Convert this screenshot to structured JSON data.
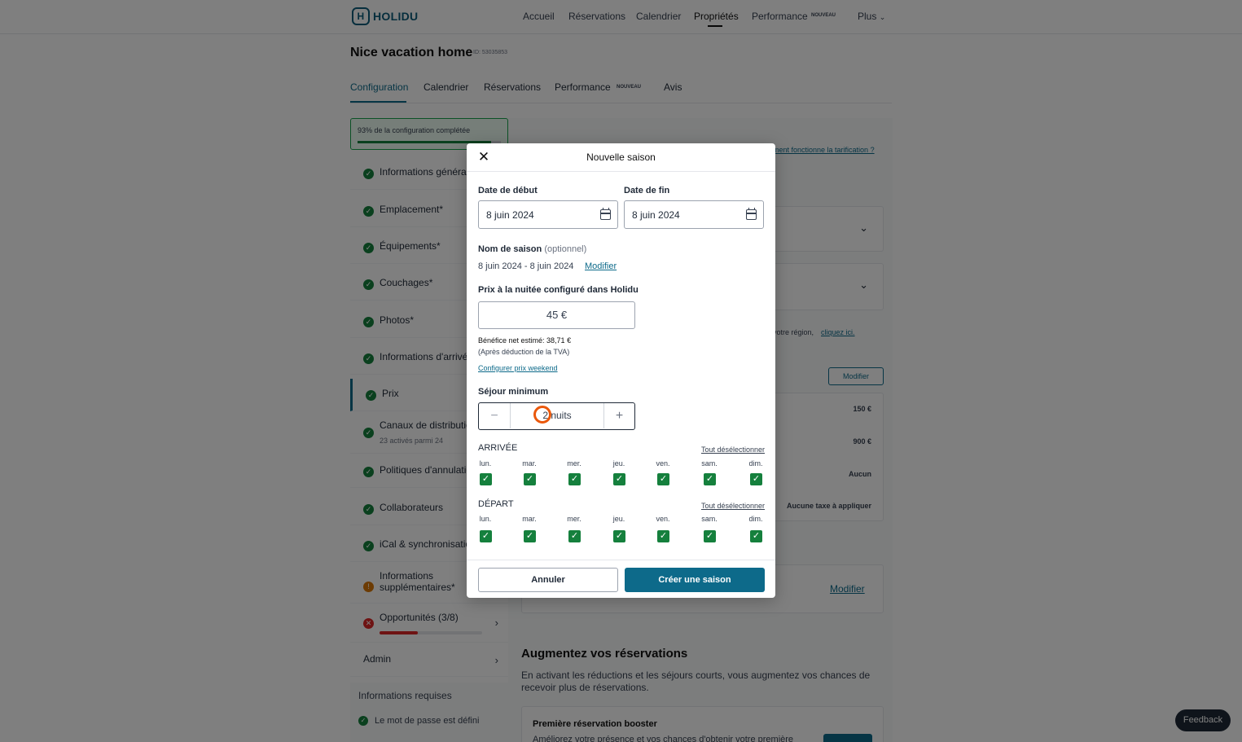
{
  "header": {
    "logo": "HOLIDU",
    "nav": [
      "Accueil",
      "Réservations",
      "Calendrier",
      "Propriétés",
      "Performance",
      "Plus"
    ],
    "performance_badge": "NOUVEAU",
    "active_nav": "Propriétés"
  },
  "property": {
    "name": "Nice vacation home",
    "id_label": "ID: 53035853"
  },
  "subtabs": {
    "items": [
      "Configuration",
      "Calendrier",
      "Réservations",
      "Performance",
      "Avis"
    ],
    "performance_badge": "NOUVEAU",
    "active": "Configuration"
  },
  "setup_progress": {
    "label": "93% de la configuration complétée",
    "percent": 93
  },
  "sidebar": {
    "items": [
      {
        "label": "Informations générales",
        "status": "done"
      },
      {
        "label": "Emplacement*",
        "status": "done"
      },
      {
        "label": "Équipements*",
        "status": "done"
      },
      {
        "label": "Couchages*",
        "status": "done"
      },
      {
        "label": "Photos*",
        "status": "done"
      },
      {
        "label": "Informations d'arrivée",
        "status": "done"
      },
      {
        "label": "Prix",
        "status": "done"
      },
      {
        "label": "Canaux de distribution",
        "sub": "23 activés parmi 24",
        "status": "done"
      },
      {
        "label": "Politiques d'annulation",
        "status": "done"
      },
      {
        "label": "Collaborateurs",
        "status": "done"
      },
      {
        "label": "iCal & synchronisation",
        "status": "done"
      },
      {
        "label": "Informations",
        "label2": "supplémentaires*",
        "status": "warning"
      },
      {
        "label": "Opportunités (3/8)",
        "status": "error",
        "progress": 0.375
      },
      {
        "label": "Admin"
      }
    ],
    "required_info": {
      "title": "Informations requises",
      "items": [
        "Le mot de passe est défini"
      ]
    }
  },
  "right_panel": {
    "pricing_link": "…ment fonctionne la tarification ?",
    "region_text": "…votre région,",
    "region_link": "cliquez ici.",
    "modify_label": "Modifier",
    "values": [
      "150 €",
      "900 €",
      "Aucun",
      "Aucune taxe à appliquer"
    ],
    "modify_link2": "Modifier",
    "increase_title": "Augmentez vos réservations",
    "increase_text": "En activant les réductions et les séjours courts, vous augmentez vos chances de recevoir plus de réservations.",
    "booster_title": "Première réservation booster",
    "booster_text": "Améliorez votre présence et vos chances d'obtenir votre première"
  },
  "feedback_label": "Feedback",
  "modal": {
    "title": "Nouvelle saison",
    "start_label": "Date de début",
    "start_value": "8 juin 2024",
    "end_label": "Date de fin",
    "end_value": "8 juin 2024",
    "season_name_label": "Nom de saison",
    "season_name_optional": "(optionnel)",
    "season_name_value": "8 juin 2024 - 8 juin 2024",
    "season_name_modify": "Modifier",
    "price_label": "Prix à la nuitée configuré dans Holidu",
    "price_value": "45 €",
    "net_profit": "Bénéfice net estimé: 38,71 €",
    "vat_note": "(Après déduction de la TVA)",
    "weekend_link": "Configurer prix weekend",
    "min_stay_label": "Séjour minimum",
    "min_stay_value": "2 nuits",
    "arrival_label": "ARRIVÉE",
    "departure_label": "DÉPART",
    "deselect_all": "Tout désélectionner",
    "days": [
      "lun.",
      "mar.",
      "mer.",
      "jeu.",
      "ven.",
      "sam.",
      "dim."
    ],
    "arrival_checked": [
      true,
      true,
      true,
      true,
      true,
      true,
      true
    ],
    "departure_checked": [
      true,
      true,
      true,
      true,
      true,
      true,
      true
    ],
    "cancel": "Annuler",
    "create": "Créer une saison"
  }
}
